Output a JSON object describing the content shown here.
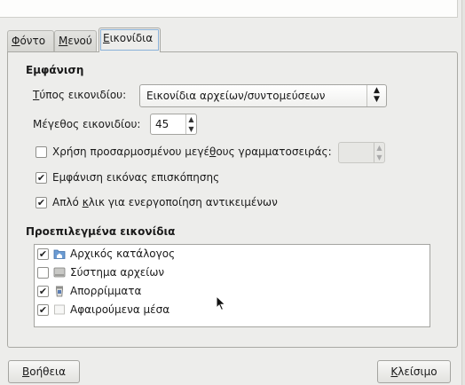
{
  "tabs": [
    {
      "label_pre": "",
      "label_u": "Φ",
      "label_post": "όντο"
    },
    {
      "label_pre": "",
      "label_u": "Μ",
      "label_post": "ενού"
    },
    {
      "label_pre": "",
      "label_u": "Ε",
      "label_post": "ικονίδια"
    }
  ],
  "appearance": {
    "title": "Εμφάνιση",
    "icon_type_label_u": "Τ",
    "icon_type_label_rest": "ύπος εικονιδίου:",
    "icon_type_value": "Εικονίδια αρχείων/συντομεύσεων",
    "icon_size_label": "Μέγεθος εικονιδίου:",
    "icon_size_value": "45",
    "custom_font_label_pre": "Χρήση προσαρμοσμένου μεγέ",
    "custom_font_label_u": "θ",
    "custom_font_label_post": "ους γραμματοσειράς:",
    "custom_font_checked": false,
    "preview_label": "Εμφάνιση εικόνας επισκόπησης",
    "preview_checked": true,
    "single_click_label_pre": "Απλό ",
    "single_click_label_u": "κ",
    "single_click_label_post": "λικ για ενεργοποίηση αντικειμένων",
    "single_click_checked": true
  },
  "default_icons": {
    "title": "Προεπιλεγμένα εικονίδια",
    "items": [
      {
        "label": "Αρχικός κατάλογος",
        "checked": true,
        "icon": "home-folder-icon"
      },
      {
        "label": "Σύστημα αρχείων",
        "checked": false,
        "icon": "drive-icon"
      },
      {
        "label": "Απορρίμματα",
        "checked": true,
        "icon": "trash-icon"
      },
      {
        "label": "Αφαιρούμενα μέσα",
        "checked": true,
        "icon": "removable-media-icon"
      }
    ]
  },
  "buttons": {
    "help_u": "Β",
    "help_rest": "οήθεια",
    "close_u": "Κ",
    "close_rest": "λείσιμο"
  }
}
